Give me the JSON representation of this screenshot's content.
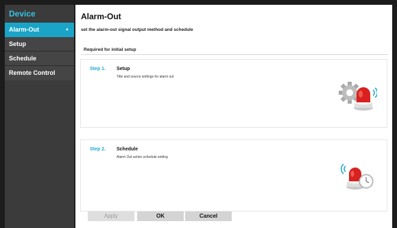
{
  "sidebar": {
    "title": "Device",
    "items": [
      {
        "label": "Alarm-Out",
        "active": true,
        "caret": "▲"
      },
      {
        "label": "Setup"
      },
      {
        "label": "Schedule"
      },
      {
        "label": "Remote Control"
      }
    ]
  },
  "main": {
    "title": "Alarm-Out",
    "subtitle": "set the alarm-out signal output method and schedule",
    "section_label": "Required for initial setup",
    "steps": [
      {
        "number": "Step 1.",
        "name": "Setup",
        "description": "Title and source settings for alarm out",
        "icon": "gear-alarm-light-icon"
      },
      {
        "number": "Step 2.",
        "name": "Schedule",
        "description": "Alarm Out action schedule setting",
        "icon": "alarm-light-clock-icon"
      }
    ]
  },
  "footer": {
    "apply_label": "Apply",
    "ok_label": "OK",
    "cancel_label": "Cancel"
  },
  "colors": {
    "accent": "#1aa5c8",
    "title_accent": "#33c3e4",
    "sidebar_bg": "#3b3b3b",
    "alarm_red": "#d9211f"
  }
}
